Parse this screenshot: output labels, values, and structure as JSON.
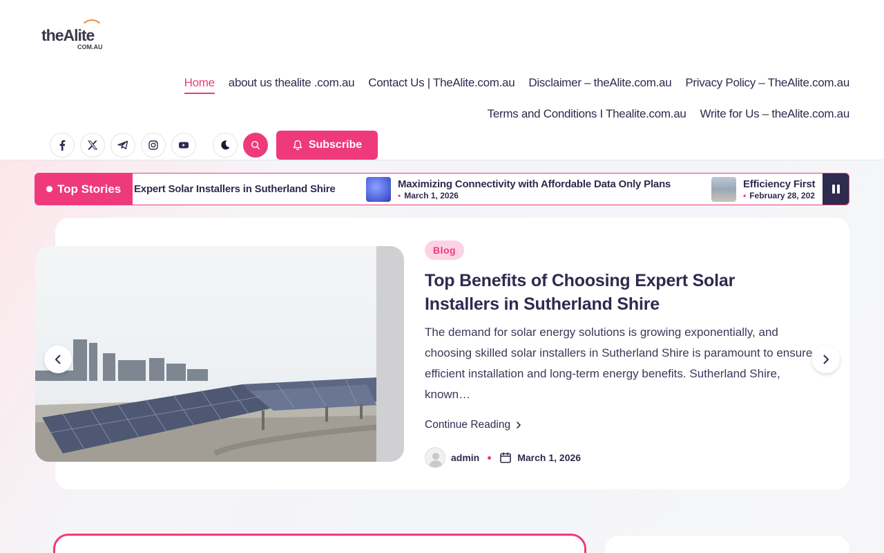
{
  "logo": {
    "main": "theAlite",
    "sub": "COM.AU"
  },
  "nav": {
    "row1": [
      "Home",
      "about us thealite .com.au",
      "Contact Us | TheAlite.com.au",
      "Disclaimer – theAlite.com.au",
      "Privacy Policy – TheAlite.com.au"
    ],
    "row2": [
      "Terms and Conditions I Thealite.com.au",
      "Write for Us – theAlite.com.au"
    ]
  },
  "social_icons": [
    "facebook-icon",
    "x-icon",
    "telegram-icon",
    "instagram-icon",
    "youtube-icon"
  ],
  "subscribe_label": "Subscribe",
  "ticker": {
    "label": "Top Stories",
    "items": [
      {
        "title": "Expert Solar Installers in Sutherland Shire",
        "date": ""
      },
      {
        "title": "Maximizing Connectivity with Affordable Data Only Plans",
        "date": "March 1, 2026"
      },
      {
        "title": "Efficiency First",
        "date": "February 28, 202"
      }
    ]
  },
  "feature": {
    "category": "Blog",
    "title": "Top Benefits of Choosing Expert Solar Installers in Sutherland Shire",
    "excerpt": "The demand for solar energy solutions is growing exponentially, and choosing skilled solar installers in Sutherland Shire is paramount to ensure efficient installation and long-term energy benefits. Sutherland Shire, known…",
    "continue_label": "Continue Reading",
    "author": "admin",
    "date": "March 1, 2026"
  },
  "colors": {
    "accent": "#ee3a7b",
    "dark": "#2d2b4e"
  }
}
